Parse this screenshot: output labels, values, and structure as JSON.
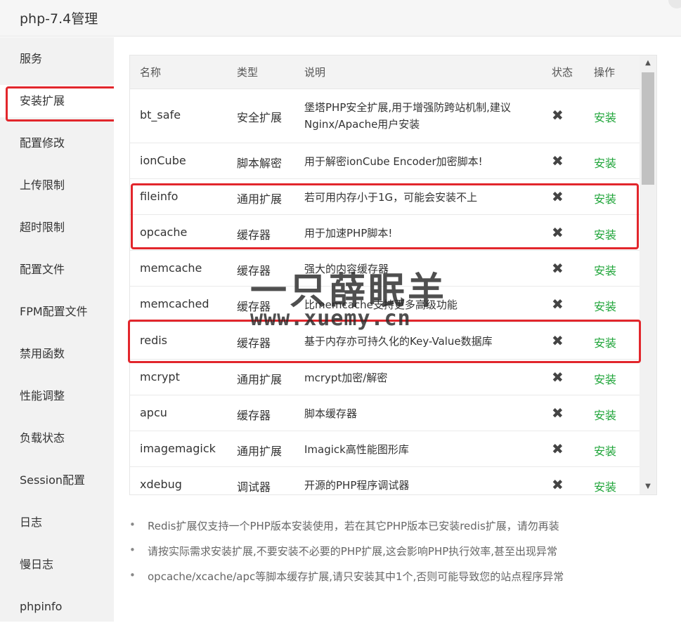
{
  "window": {
    "title": "php-7.4管理"
  },
  "sidebar": {
    "items": [
      {
        "label": "服务"
      },
      {
        "label": "安装扩展"
      },
      {
        "label": "配置修改"
      },
      {
        "label": "上传限制"
      },
      {
        "label": "超时限制"
      },
      {
        "label": "配置文件"
      },
      {
        "label": "FPM配置文件"
      },
      {
        "label": "禁用函数"
      },
      {
        "label": "性能调整"
      },
      {
        "label": "负载状态"
      },
      {
        "label": "Session配置"
      },
      {
        "label": "日志"
      },
      {
        "label": "慢日志"
      },
      {
        "label": "phpinfo"
      }
    ],
    "active_index": 1
  },
  "table": {
    "headers": {
      "name": "名称",
      "type": "类型",
      "desc": "说明",
      "status": "状态",
      "action": "操作"
    },
    "rows": [
      {
        "name": "bt_safe",
        "type": "安全扩展",
        "desc": "堡塔PHP安全扩展,用于增强防跨站机制,建议Nginx/Apache用户安装",
        "status": "✖",
        "action": "安装"
      },
      {
        "name": "ionCube",
        "type": "脚本解密",
        "desc": "用于解密ionCube Encoder加密脚本!",
        "status": "✖",
        "action": "安装"
      },
      {
        "name": "fileinfo",
        "type": "通用扩展",
        "desc": "若可用内存小于1G，可能会安装不上",
        "status": "✖",
        "action": "安装"
      },
      {
        "name": "opcache",
        "type": "缓存器",
        "desc": "用于加速PHP脚本!",
        "status": "✖",
        "action": "安装"
      },
      {
        "name": "memcache",
        "type": "缓存器",
        "desc": "强大的内容缓存器",
        "status": "✖",
        "action": "安装"
      },
      {
        "name": "memcached",
        "type": "缓存器",
        "desc": "比memcache支持更多高级功能",
        "status": "✖",
        "action": "安装"
      },
      {
        "name": "redis",
        "type": "缓存器",
        "desc": "基于内存亦可持久化的Key-Value数据库",
        "status": "✖",
        "action": "安装"
      },
      {
        "name": "mcrypt",
        "type": "通用扩展",
        "desc": "mcrypt加密/解密",
        "status": "✖",
        "action": "安装"
      },
      {
        "name": "apcu",
        "type": "缓存器",
        "desc": "脚本缓存器",
        "status": "✖",
        "action": "安装"
      },
      {
        "name": "imagemagick",
        "type": "通用扩展",
        "desc": "Imagick高性能图形库",
        "status": "✖",
        "action": "安装"
      },
      {
        "name": "xdebug",
        "type": "调试器",
        "desc": "开源的PHP程序调试器",
        "status": "✖",
        "action": "安装"
      }
    ]
  },
  "notes": [
    "Redis扩展仅支持一个PHP版本安装使用，若在其它PHP版本已安装redis扩展，请勿再装",
    "请按实际需求安装扩展,不要安装不必要的PHP扩展,这会影响PHP执行效率,甚至出现异常",
    "opcache/xcache/apc等脚本缓存扩展,请只安装其中1个,否则可能导致您的站点程序异常"
  ],
  "watermark": {
    "title": "一只薛眠羊",
    "url": "www.xuemy.cn"
  },
  "colors": {
    "install_green": "#20a53a",
    "highlight_red": "#e2262c",
    "sidebar_bg": "#f2f2f2"
  },
  "icons": {
    "status_not_installed": "x-mark-icon",
    "scroll_up": "triangle-up-icon",
    "scroll_down": "triangle-down-icon"
  }
}
